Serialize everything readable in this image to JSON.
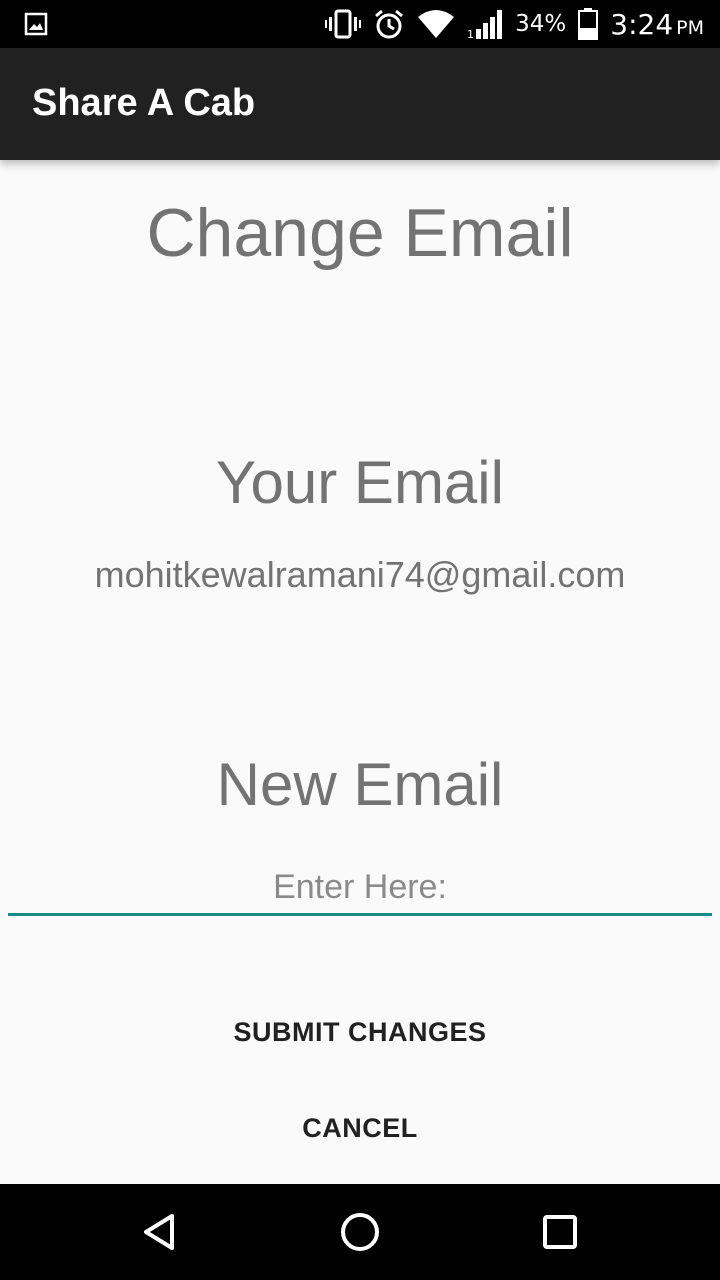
{
  "status_bar": {
    "icons": [
      "gallery-icon",
      "vibrate-icon",
      "alarm-icon",
      "wifi-icon",
      "signal-icon",
      "battery-icon"
    ],
    "battery_percent": "34%",
    "time": "3:24",
    "ampm": "PM"
  },
  "app_bar": {
    "title": "Share A Cab"
  },
  "main": {
    "page_title": "Change Email",
    "current_email_label": "Your Email",
    "current_email_value": "mohitkewalramani74@gmail.com",
    "new_email_label": "New Email",
    "new_email_input": {
      "value": "",
      "placeholder": "Enter Here:"
    },
    "submit_label": "SUBMIT CHANGES",
    "cancel_label": "CANCEL"
  },
  "nav_bar": {
    "icons": [
      "back-icon",
      "home-icon",
      "recents-icon"
    ]
  },
  "colors": {
    "app_bar": "#212121",
    "accent": "#1b8a80",
    "heading_text": "#737373",
    "background": "#fafafa"
  }
}
